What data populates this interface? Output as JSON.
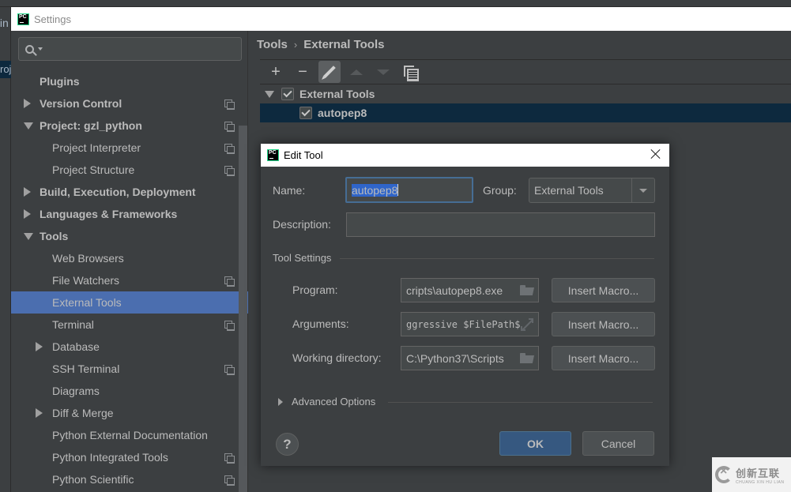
{
  "background": {
    "left_fragment_1": "tin",
    "left_fragment_2": "roj"
  },
  "settings": {
    "window_title": "Settings",
    "search": {
      "placeholder": "",
      "value": ""
    },
    "nav": [
      {
        "label": "Plugins",
        "bold": true,
        "level": 0,
        "arrow": "none",
        "project_icon": false
      },
      {
        "label": "Version Control",
        "bold": true,
        "level": 0,
        "arrow": "right",
        "project_icon": true
      },
      {
        "label": "Project: gzl_python",
        "bold": true,
        "level": 0,
        "arrow": "down",
        "project_icon": true
      },
      {
        "label": "Project Interpreter",
        "bold": false,
        "level": 1,
        "arrow": "none",
        "project_icon": true
      },
      {
        "label": "Project Structure",
        "bold": false,
        "level": 1,
        "arrow": "none",
        "project_icon": true
      },
      {
        "label": "Build, Execution, Deployment",
        "bold": true,
        "level": 0,
        "arrow": "right",
        "project_icon": false
      },
      {
        "label": "Languages & Frameworks",
        "bold": true,
        "level": 0,
        "arrow": "right",
        "project_icon": false
      },
      {
        "label": "Tools",
        "bold": true,
        "level": 0,
        "arrow": "down",
        "project_icon": false
      },
      {
        "label": "Web Browsers",
        "bold": false,
        "level": 1,
        "arrow": "none",
        "project_icon": false
      },
      {
        "label": "File Watchers",
        "bold": false,
        "level": 1,
        "arrow": "none",
        "project_icon": true
      },
      {
        "label": "External Tools",
        "bold": false,
        "level": 1,
        "arrow": "none",
        "project_icon": false,
        "selected": true
      },
      {
        "label": "Terminal",
        "bold": false,
        "level": 1,
        "arrow": "none",
        "project_icon": true
      },
      {
        "label": "Database",
        "bold": false,
        "level": 1,
        "arrow": "right",
        "project_icon": false
      },
      {
        "label": "SSH Terminal",
        "bold": false,
        "level": 1,
        "arrow": "none",
        "project_icon": true
      },
      {
        "label": "Diagrams",
        "bold": false,
        "level": 1,
        "arrow": "none",
        "project_icon": false
      },
      {
        "label": "Diff & Merge",
        "bold": false,
        "level": 1,
        "arrow": "right",
        "project_icon": false
      },
      {
        "label": "Python External Documentation",
        "bold": false,
        "level": 1,
        "arrow": "none",
        "project_icon": false
      },
      {
        "label": "Python Integrated Tools",
        "bold": false,
        "level": 1,
        "arrow": "none",
        "project_icon": true
      },
      {
        "label": "Python Scientific",
        "bold": false,
        "level": 1,
        "arrow": "none",
        "project_icon": true
      }
    ],
    "breadcrumb": {
      "parent": "Tools",
      "separator": "›",
      "current": "External Tools"
    },
    "toolbar": {
      "add": "+",
      "remove": "−"
    },
    "external_tools_tree": {
      "group": {
        "label": "External Tools",
        "checked": true,
        "expanded": true
      },
      "items": [
        {
          "label": "autopep8",
          "checked": true,
          "selected": true
        }
      ]
    }
  },
  "dialog": {
    "title": "Edit Tool",
    "name_label": "Name:",
    "name_value": "autopep8",
    "group_label": "Group:",
    "group_value": "External Tools",
    "description_label": "Description:",
    "description_value": "",
    "tool_settings_label": "Tool Settings",
    "program_label": "Program:",
    "program_value": "cripts\\autopep8.exe",
    "arguments_label": "Arguments:",
    "arguments_value": "ggressive $FilePath$",
    "working_dir_label": "Working directory:",
    "working_dir_value": "C:\\Python37\\Scripts",
    "insert_macro_label": "Insert Macro...",
    "advanced_options_label": "Advanced Options",
    "help_label": "?",
    "ok_label": "OK",
    "cancel_label": "Cancel"
  },
  "watermark": {
    "cn": "创新互联",
    "en": "CHUANG XIN HU LIAN"
  },
  "colors": {
    "background": "#3c3f41",
    "selection_nav": "#4b6eaf",
    "selection_tree": "#0d293e",
    "ok_button": "#365880",
    "text": "#bbbbbb"
  }
}
